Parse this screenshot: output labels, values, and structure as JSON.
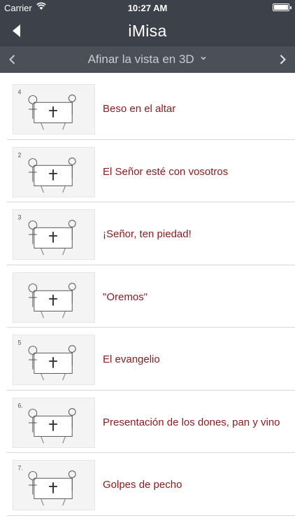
{
  "status_bar": {
    "carrier": "Carrier",
    "time": "10:27 AM",
    "battery_level": 1.0
  },
  "navbar": {
    "title": "iMisa",
    "back_icon": "back-arrow-icon"
  },
  "subnav": {
    "label": "Afinar la vista en 3D",
    "prev_icon": "chevron-left-icon",
    "next_icon": "chevron-right-icon",
    "dropdown_icon": "chevron-down-icon"
  },
  "items": [
    {
      "label": "Beso en el altar",
      "thumb_number": "4"
    },
    {
      "label": "El Señor esté con vosotros",
      "thumb_number": "2"
    },
    {
      "label": "¡Señor, ten piedad!",
      "thumb_number": "3"
    },
    {
      "label": "\"Oremos\"",
      "thumb_number": ""
    },
    {
      "label": "El evangelio",
      "thumb_number": "5"
    },
    {
      "label": "Presentación de los dones, pan y vino",
      "thumb_number": "6."
    },
    {
      "label": "Golpes de pecho",
      "thumb_number": "7."
    }
  ],
  "colors": {
    "header_bg": "#3d4149",
    "subnav_bg": "#4b5058",
    "item_text": "#8c1c22"
  }
}
